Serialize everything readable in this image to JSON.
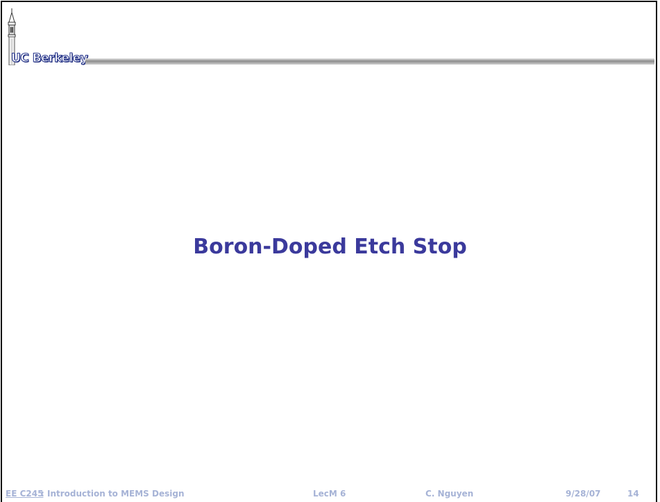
{
  "header": {
    "logo_text": "UC Berkeley"
  },
  "slide": {
    "title": "Boron-Doped Etch Stop"
  },
  "footer": {
    "course_code": "EE C245",
    "course_title": ": Introduction to MEMS Design",
    "lecture": "LecM 6",
    "instructor": "C. Nguyen",
    "date": "9/28/07",
    "page_number": "14"
  },
  "colors": {
    "title": "#3b3a9c",
    "footer_text": "#a6b3d6",
    "header_rule_dark": "#8c8c8c",
    "header_rule_light": "#e6e6e6",
    "logo_outline": "#2b3a8f"
  }
}
